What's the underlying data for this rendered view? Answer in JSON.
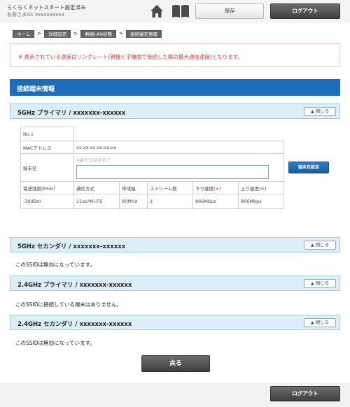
{
  "header": {
    "status": "らくらくネットスタート設定済み",
    "customer_id": "お客さまID: xxxxxxxxxx",
    "save_label": "保存",
    "logout_label": "ログアウト"
  },
  "breadcrumb": [
    "ホーム",
    "詳細設定",
    "無線LAN状態",
    "接続端末情報"
  ],
  "breadcrumb_sep": ">",
  "notice": "※ 表示されている速度はリンクレート(親機と子機間で接続した際の最大通信速度)となります。",
  "section_title": "接続端末情報",
  "close_label": "閉じる",
  "bands": [
    {
      "title": "5GHz プライマリ / xxxxxxx-xxxxxx"
    },
    {
      "title": "5GHz セカンダリ / xxxxxxx-xxxxxx",
      "message": "このSSIDは無効になっています。"
    },
    {
      "title": "2.4GHz プライマリ / xxxxxxx-xxxxxx",
      "message": "このSSIDに接続している端末はありません。"
    },
    {
      "title": "2.4GHz セカンダリ / xxxxxxx-xxxxxx",
      "message": "このSSIDは無効になっています。"
    }
  ],
  "device": {
    "number": "No.1",
    "mac_label": "MACアドレス",
    "mac_value": "xx:xx:xx:xx:xx:xx",
    "name_label": "端末名",
    "name_placeholder": "※最大32文字まで",
    "name_value": "",
    "set_name_button": "端末名設定",
    "col_headers": [
      "電波強度(RSSI)",
      "通信方式",
      "帯域幅",
      "ストリーム数",
      "下り速度(",
      "上り速度("
    ],
    "asterisk": "※",
    "close_paren": ")",
    "values": [
      "-30dBm",
      "11ac/Wi-Fi5",
      "80MHz",
      "2",
      "866Mbps",
      "866Mbps"
    ]
  },
  "back_label": "戻る",
  "footer_logout_label": "ログアウト",
  "colors": {
    "section_header": "#1e6db8",
    "band_bg": "#dceefa",
    "notice_text": "#d63b3b",
    "dark_button": "#4a4a4a"
  },
  "icons": [
    "home-icon",
    "manual-book-icon",
    "chevron-up-icon"
  ]
}
